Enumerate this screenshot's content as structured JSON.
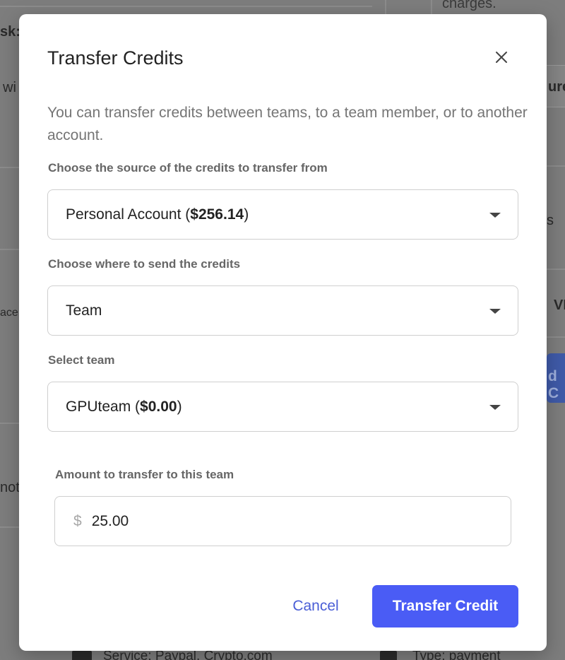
{
  "background": {
    "top_right_text": "charges.",
    "left_fragment_1": "sk:",
    "left_fragment_2": "wi",
    "left_fragment_3": "ace",
    "left_fragment_4": "not",
    "right_fragment_1": "ure",
    "right_fragment_2": "s",
    "right_fragment_3": "VI",
    "right_button_fragment": "d C",
    "bottom_service_text": "Service: Paypal, Crypto.com",
    "bottom_type_text": "Type: payment"
  },
  "modal": {
    "title": "Transfer Credits",
    "description": "You can transfer credits between teams, to a team member, or to another account.",
    "source": {
      "label": "Choose the source of the credits to transfer from",
      "selected_name": "Personal Account (",
      "selected_amount": "$256.14",
      "selected_suffix": ")"
    },
    "destination": {
      "label": "Choose where to send the credits",
      "selected": "Team"
    },
    "team": {
      "label": "Select team",
      "selected_name": "GPUteam (",
      "selected_amount": "$0.00",
      "selected_suffix": ")"
    },
    "amount": {
      "label": "Amount to transfer to this team",
      "prefix": "$",
      "value": "25.00"
    },
    "cancel_label": "Cancel",
    "submit_label": "Transfer Credit"
  },
  "colors": {
    "primary": "#4a5cf5",
    "link": "#4a5ed6",
    "overlay": "#7d7d7d"
  }
}
